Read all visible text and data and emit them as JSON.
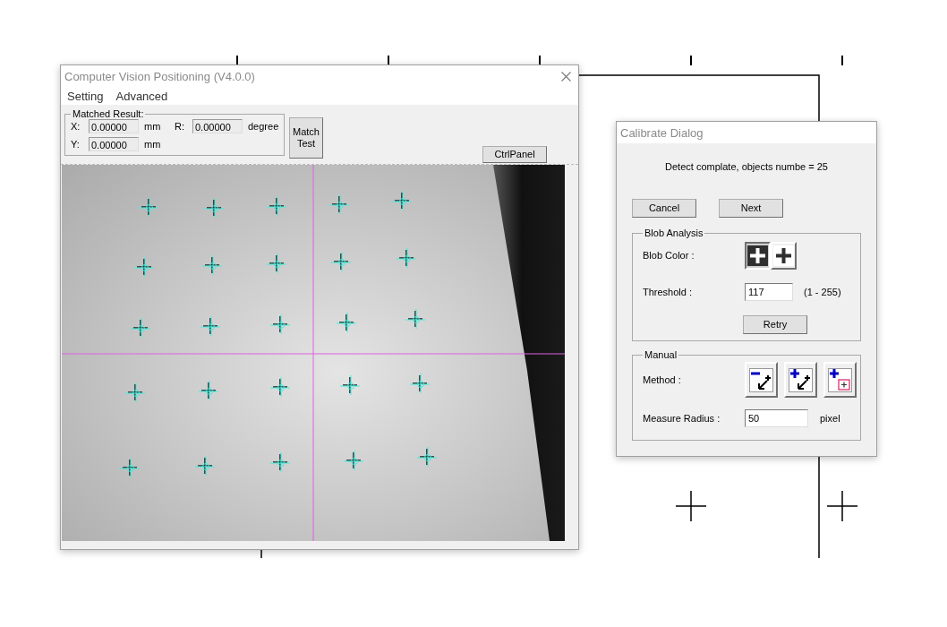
{
  "main_window": {
    "title": "Computer Vision Positioning (V4.0.0)",
    "menu": [
      "Setting",
      "Advanced"
    ],
    "matched_result": {
      "label": "Matched Result:",
      "fields": [
        {
          "label": "X:",
          "value": "0.00000",
          "unit": "mm"
        },
        {
          "label": "R:",
          "value": "0.00000",
          "unit": "degree"
        },
        {
          "label": "Y:",
          "value": "0.00000",
          "unit": "mm"
        }
      ]
    },
    "match_button": "Match Test",
    "ctrl_panel_button": "CtrlPanel"
  },
  "calibrate_dialog": {
    "title": "Calibrate Dialog",
    "status": "Detect complate, objects numbe = 25",
    "buttons": [
      "Cancel",
      "Next"
    ],
    "blob_analysis": {
      "label": "Blob Analysis",
      "blob_color_label": "Blob Color :",
      "blob_colors": [
        {
          "kind": "light-on-dark",
          "selected": true
        },
        {
          "kind": "dark-on-light",
          "selected": false
        }
      ],
      "threshold_label": "Threshold :",
      "threshold": "117",
      "threshold_range": "(1 - 255)",
      "retry_button": "Retry"
    },
    "manual": {
      "label": "Manual",
      "method_label": "Method :",
      "methods": [
        {
          "kind": "remove"
        },
        {
          "kind": "add"
        },
        {
          "kind": "add-box"
        }
      ],
      "radius_label": "Measure Radius :",
      "radius": "50",
      "radius_unit": "pixel"
    }
  }
}
